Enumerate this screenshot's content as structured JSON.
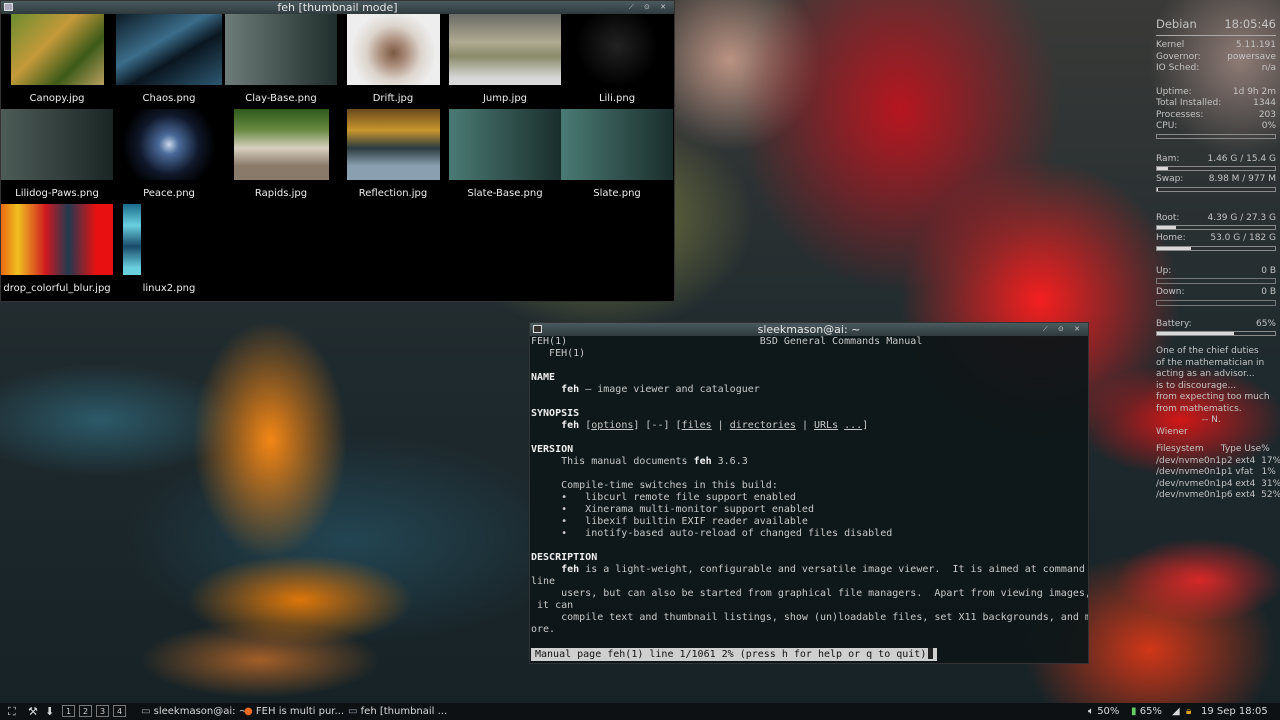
{
  "feh": {
    "title": "feh [thumbnail mode]",
    "thumbs": [
      {
        "name": "Canopy.jpg",
        "bg": "linear-gradient(135deg,#6b8c2e,#c49a3a 40%,#3c5a18 70%,#b9a060)",
        "w": 93
      },
      {
        "name": "Chaos.png",
        "bg": "linear-gradient(150deg,#0d1c26,#3b6d8a 40%,#0a1620 60%,#2d5870)",
        "w": 106
      },
      {
        "name": "Clay-Base.png",
        "bg": "linear-gradient(90deg,#6d7c78,#1f2e2c)",
        "w": 112
      },
      {
        "name": "Drift.jpg",
        "bg": "radial-gradient(circle at 50% 55%,#7c5a44 0,#a88a78 20%,#dcd4cc 45%,#eee 70%)",
        "w": 93
      },
      {
        "name": "Jump.jpg",
        "bg": "linear-gradient(180deg,#6c6c66 0,#b0aa92 40%,#8a8a6a 60%,#d8d8d8 90%)",
        "w": 112
      },
      {
        "name": "Lili.png",
        "bg": "radial-gradient(circle at 50% 45%,#222 0,#111 30%,#000 60%)",
        "w": 112
      },
      {
        "name": "Lilidog-Paws.png",
        "bg": "linear-gradient(90deg,#4e5c58,#1a2624)",
        "w": 112
      },
      {
        "name": "Peace.png",
        "bg": "radial-gradient(circle at 50% 50%,#c8d8e8 0,#4a6a9a 15%,#10182a 45%,#000 70%)",
        "w": 112
      },
      {
        "name": "Rapids.jpg",
        "bg": "linear-gradient(180deg,#2e5a1c 0,#6a8a44 30%,#d8d0c0 55%,#8a7a6a 80%)",
        "w": 95
      },
      {
        "name": "Reflection.jpg",
        "bg": "linear-gradient(180deg,#6a4a1c 0,#c8962c 30%,#2a3a40 55%,#8aa0b0 80%)",
        "w": 93
      },
      {
        "name": "Slate-Base.png",
        "bg": "linear-gradient(90deg,#4a7a74,#1a2e2c)",
        "w": 112
      },
      {
        "name": "Slate.png",
        "bg": "linear-gradient(90deg,#4a7a74,#1a2e2c)",
        "w": 112
      },
      {
        "name": "drop_colorful_blur.jpg",
        "bg": "linear-gradient(90deg,#e86a10 0,#f0c020 15%,#d01820 40%,#203a50 60%,#e81010 85%)",
        "w": 112
      },
      {
        "name": "linux2.png",
        "bg": "linear-gradient(180deg,#1a6a8a 0,#6ad0e0 30%,#1a4a6a 60%,#6ad0e0 90%)",
        "w": 18
      }
    ]
  },
  "term": {
    "title": "sleekmason@ai: ~",
    "status": "Manual page feh(1) line 1/1061 2% (press h for help or q to quit)"
  },
  "conky": {
    "os": "Debian",
    "time": "18:05:46",
    "sys": [
      {
        "k": "Kernel",
        "v": "5.11.191"
      },
      {
        "k": "Governor:",
        "v": "powersave"
      },
      {
        "k": "IO Sched:",
        "v": "n/a"
      }
    ],
    "stats": [
      {
        "k": "Uptime:",
        "v": "1d 9h 2m"
      },
      {
        "k": "Total Installed:",
        "v": "1344"
      },
      {
        "k": "Processes:",
        "v": "203"
      },
      {
        "k": "CPU:",
        "v": "0%"
      }
    ],
    "cpu_pct": 0,
    "ram": {
      "k": "Ram:",
      "v": "1.46 G  / 15.4 G",
      "pct": 9.5
    },
    "swap": {
      "k": "Swap:",
      "v": "8.98 M  / 977 M",
      "pct": 1
    },
    "root": {
      "k": "Root:",
      "v": "4.39 G / 27.3 G",
      "pct": 16
    },
    "home": {
      "k": "Home:",
      "v": "53.0 G / 182 G",
      "pct": 29
    },
    "up": {
      "k": "Up:",
      "v": "0 B"
    },
    "down": {
      "k": "Down:",
      "v": "0 B"
    },
    "battery": {
      "k": "Battery:",
      "v": "65%",
      "pct": 65
    },
    "quote": "One of the chief duties\nof the mathematician in\nacting as an advisor...\nis to discourage...\nfrom expecting too much\nfrom mathematics.\n                -- N.\nWiener",
    "fs": "Filesystem      Type Use%\n/dev/nvme0n1p2 ext4  17%\n/dev/nvme0n1p1 vfat   1%\n/dev/nvme0n1p4 ext4  31%\n/dev/nvme0n1p6 ext4  52%"
  },
  "taskbar": {
    "workspaces": [
      "1",
      "2",
      "3",
      "4"
    ],
    "tasks": [
      "sleekmason@ai: ~",
      "FEH is multi pur...",
      "feh [thumbnail ..."
    ],
    "volume": "50%",
    "battery": "65%",
    "clock": "19 Sep 18:05"
  }
}
